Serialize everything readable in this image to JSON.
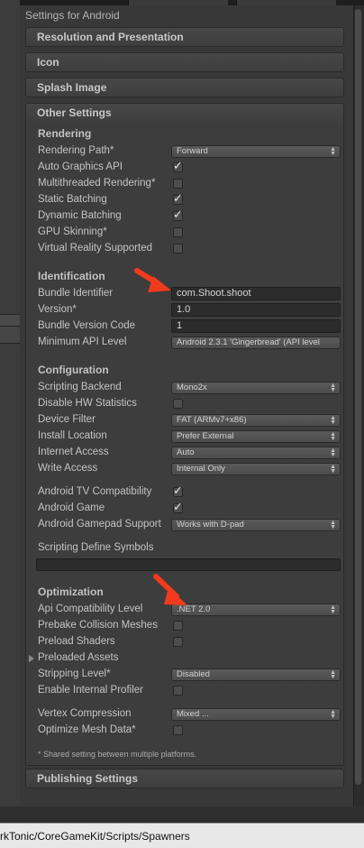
{
  "header": {
    "title": "Settings for Android"
  },
  "sections": {
    "resolution": "Resolution and Presentation",
    "icon": "Icon",
    "splash": "Splash Image",
    "other": "Other Settings",
    "publishing": "Publishing Settings"
  },
  "rendering": {
    "heading": "Rendering",
    "rendering_path": {
      "label": "Rendering Path*",
      "value": "Forward"
    },
    "auto_graphics_api": {
      "label": "Auto Graphics API",
      "checked": true
    },
    "multithreaded_rendering": {
      "label": "Multithreaded Rendering*",
      "checked": false
    },
    "static_batching": {
      "label": "Static Batching",
      "checked": true
    },
    "dynamic_batching": {
      "label": "Dynamic Batching",
      "checked": true
    },
    "gpu_skinning": {
      "label": "GPU Skinning*",
      "checked": false
    },
    "virtual_reality": {
      "label": "Virtual Reality Supported",
      "checked": false
    }
  },
  "identification": {
    "heading": "Identification",
    "bundle_identifier": {
      "label": "Bundle Identifier",
      "value": "com.Shoot.shoot"
    },
    "version": {
      "label": "Version*",
      "value": "1.0"
    },
    "bundle_version_code": {
      "label": "Bundle Version Code",
      "value": "1"
    },
    "minimum_api_level": {
      "label": "Minimum API Level",
      "value": "Android 2.3.1 'Gingerbread' (API level"
    }
  },
  "configuration": {
    "heading": "Configuration",
    "scripting_backend": {
      "label": "Scripting Backend",
      "value": "Mono2x"
    },
    "disable_hw_statistics": {
      "label": "Disable HW Statistics",
      "checked": false
    },
    "device_filter": {
      "label": "Device Filter",
      "value": "FAT (ARMv7+x86)"
    },
    "install_location": {
      "label": "Install Location",
      "value": "Prefer External"
    },
    "internet_access": {
      "label": "Internet Access",
      "value": "Auto"
    },
    "write_access": {
      "label": "Write Access",
      "value": "Internal Only"
    },
    "android_tv": {
      "label": "Android TV Compatibility",
      "checked": true
    },
    "android_game": {
      "label": "Android Game",
      "checked": true
    },
    "gamepad_support": {
      "label": "Android Gamepad Support",
      "value": "Works with D-pad"
    },
    "scripting_define_symbols": {
      "label": "Scripting Define Symbols",
      "value": ""
    }
  },
  "optimization": {
    "heading": "Optimization",
    "api_compatibility": {
      "label": "Api Compatibility Level",
      "value": ".NET 2.0"
    },
    "prebake_collision": {
      "label": "Prebake Collision Meshes",
      "checked": false
    },
    "preload_shaders": {
      "label": "Preload Shaders",
      "checked": false
    },
    "preloaded_assets": {
      "label": "Preloaded Assets"
    },
    "stripping_level": {
      "label": "Stripping Level*",
      "value": "Disabled"
    },
    "internal_profiler": {
      "label": "Enable Internal Profiler",
      "checked": false
    },
    "vertex_compression": {
      "label": "Vertex Compression",
      "value": "Mixed ..."
    },
    "optimize_mesh_data": {
      "label": "Optimize Mesh Data*",
      "checked": false
    }
  },
  "footnote": "* Shared setting between multiple platforms.",
  "path_bar": {
    "text": "rkTonic/CoreGameKit/Scripts/Spawners"
  },
  "colors": {
    "annotation_arrow": "#f23a1c",
    "panel_bg": "#3d3d3d",
    "header_bg": "#444444"
  },
  "icons": {
    "checkmark": "check-icon",
    "dropdown": "updown-arrows-icon",
    "foldout": "triangle-right-icon",
    "annotation": "red-arrow-icon"
  }
}
